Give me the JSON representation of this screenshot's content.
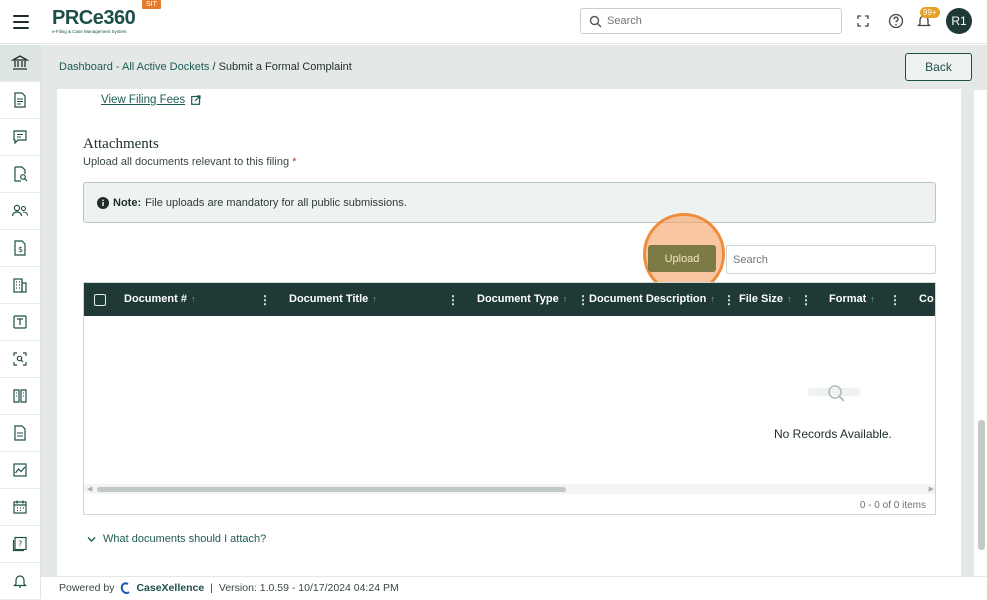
{
  "header": {
    "logo_text": "PRCe360",
    "logo_subtext": "e-Filing & Case Management System",
    "env_badge": "SIT",
    "search_placeholder": "Search",
    "notification_count": "99+",
    "user_initials": "R1"
  },
  "breadcrumb": {
    "parent": "Dashboard - All Active Dockets",
    "separator": " / ",
    "current": "Submit a Formal Complaint"
  },
  "back_label": "Back",
  "filing_fees_link": "View Filing Fees",
  "attachments": {
    "title": "Attachments",
    "subtitle": "Upload all documents relevant to this filing",
    "required_marker": "*",
    "note_label": "Note:",
    "note_text": "File uploads are mandatory for all public submissions.",
    "upload_label": "Upload",
    "search_placeholder": "Search"
  },
  "grid": {
    "columns": [
      "Document #",
      "Document Title",
      "Document Type",
      "Document Description",
      "File Size",
      "Format",
      "Co"
    ],
    "empty_text": "No Records Available.",
    "pager_text": "0 - 0 of 0 items"
  },
  "faq_label": "What documents should I attach?",
  "footer": {
    "powered_by": "Powered by",
    "brand": "CaseXellence",
    "separator": "|",
    "version": "Version: 1.0.59 - 10/17/2024 04:24 PM"
  },
  "sidebar_icons": [
    "bank-icon",
    "document-icon",
    "chat-icon",
    "document-search-icon",
    "users-icon",
    "invoice-icon",
    "building-icon",
    "note-icon",
    "scan-icon",
    "book-icon",
    "file-icon",
    "chart-icon",
    "calendar-icon",
    "help-book-icon",
    "bell-icon"
  ],
  "colors": {
    "brand": "#1d4f4a",
    "header_dark": "#1f3a36",
    "accent": "#e57a2a"
  }
}
